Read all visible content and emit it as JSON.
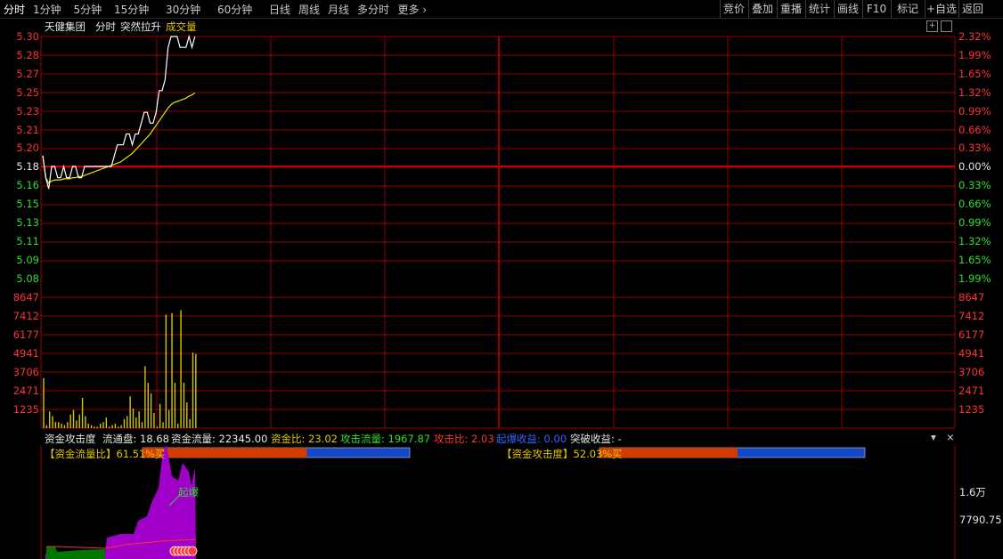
{
  "toolbar": {
    "periods": [
      "分时",
      "1分钟",
      "5分钟",
      "15分钟",
      "30分钟",
      "60分钟",
      "日线",
      "周线",
      "月线",
      "多分时"
    ],
    "more": "更多",
    "more_icon": "chevron-right",
    "buttons": [
      "竞价",
      "叠加",
      "重播",
      "统计",
      "画线",
      "F10",
      "标记",
      "+自选",
      "返回"
    ]
  },
  "header": {
    "stock_name": "天健集团",
    "view": "分时",
    "indicator": "突然拉升",
    "volume_label": "成交量"
  },
  "price_axis": {
    "left_up": [
      "5.30",
      "5.28",
      "5.27",
      "5.25",
      "5.23",
      "5.21",
      "5.20"
    ],
    "ref": "5.18",
    "left_down": [
      "5.16",
      "5.15",
      "5.13",
      "5.11",
      "5.09",
      "5.08"
    ],
    "right_up": [
      "2.32%",
      "1.99%",
      "1.65%",
      "1.32%",
      "0.99%",
      "0.66%",
      "0.33%"
    ],
    "right_ref": "0.00%",
    "right_down": [
      "0.33%",
      "0.66%",
      "0.99%",
      "1.32%",
      "1.65%",
      "1.99%"
    ]
  },
  "volume_axis": [
    "8647",
    "7412",
    "6177",
    "4941",
    "3706",
    "2471",
    "1235"
  ],
  "indicator_bar": {
    "name": "资金攻击度",
    "items": [
      {
        "label": "流通盘: 18.68",
        "color": "#e6e6e6"
      },
      {
        "label": "资金流量: 22345.00",
        "color": "#e6e6e6"
      },
      {
        "label": "资金比: 23.02",
        "color": "#e6c800"
      },
      {
        "label": "攻击流量: 1967.87",
        "color": "#32dc32"
      },
      {
        "label": "攻击比: 2.03",
        "color": "#ff3232"
      },
      {
        "label": "起爆收益: 0.00",
        "color": "#3264ff"
      },
      {
        "label": "突破收益: -",
        "color": "#e6e6e6"
      }
    ]
  },
  "flow_ratio": {
    "label": "【资金流量比】61.51",
    "pct": "%买",
    "fill": 0.6151
  },
  "attack_deg": {
    "label": "【资金攻击度】52.03",
    "pct": "%买",
    "fill": 0.5203
  },
  "sub_axis": [
    "1.6万",
    "7790.75"
  ],
  "signal": "起爆",
  "colors": {
    "grid": "#9a0000",
    "price": "#ffffff",
    "avg": "#e6e600",
    "bar_buy": "#d23c00",
    "bar_sell": "#1446c8",
    "purple": "#a000c8",
    "green_fill": "#007800"
  },
  "chart_data": {
    "type": "line",
    "title": "天健集团 分时",
    "prev_close": 5.18,
    "price": [
      5.19,
      5.17,
      5.16,
      5.18,
      5.18,
      5.17,
      5.17,
      5.18,
      5.17,
      5.17,
      5.18,
      5.18,
      5.17,
      5.17,
      5.18,
      5.18,
      5.18,
      5.18,
      5.18,
      5.18,
      5.18,
      5.18,
      5.18,
      5.18,
      5.19,
      5.2,
      5.2,
      5.2,
      5.21,
      5.21,
      5.2,
      5.21,
      5.21,
      5.22,
      5.23,
      5.23,
      5.22,
      5.22,
      5.23,
      5.25,
      5.25,
      5.26,
      5.29,
      5.3,
      5.3,
      5.3,
      5.29,
      5.29,
      5.29,
      5.3,
      5.29,
      5.3
    ],
    "avg": [
      5.19,
      5.17,
      5.165,
      5.167,
      5.168,
      5.168,
      5.168,
      5.169,
      5.169,
      5.169,
      5.17,
      5.17,
      5.171,
      5.171,
      5.172,
      5.173,
      5.174,
      5.175,
      5.176,
      5.177,
      5.178,
      5.179,
      5.18,
      5.181,
      5.182,
      5.183,
      5.184,
      5.186,
      5.188,
      5.19,
      5.192,
      5.195,
      5.198,
      5.201,
      5.204,
      5.207,
      5.21,
      5.214,
      5.218,
      5.222,
      5.226,
      5.23,
      5.234,
      5.237,
      5.239,
      5.24,
      5.241,
      5.242,
      5.243,
      5.245,
      5.246,
      5.248
    ],
    "volume": [
      3300,
      200,
      1100,
      800,
      400,
      400,
      300,
      200,
      400,
      900,
      1200,
      500,
      900,
      2000,
      800,
      300,
      200,
      100,
      100,
      300,
      400,
      700,
      100,
      200,
      300,
      100,
      200,
      600,
      800,
      2100,
      1300,
      700,
      1100,
      400,
      4100,
      3000,
      2300,
      1000,
      100,
      1600,
      400,
      7500,
      1200,
      7600,
      3000,
      300,
      7800,
      3000,
      1700,
      600,
      5000,
      4900
    ],
    "ylim": [
      5.08,
      5.3
    ],
    "volume_ylim": [
      0,
      8647
    ]
  }
}
